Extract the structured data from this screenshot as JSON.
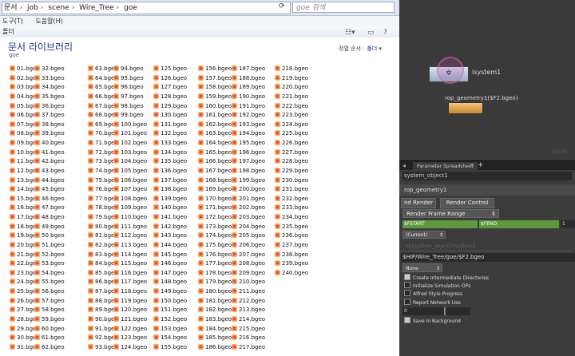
{
  "explorer": {
    "breadcrumb": [
      "문서",
      "job",
      "scene",
      "Wire_Tree",
      "goe"
    ],
    "search_placeholder": "goe 검색",
    "menu": [
      "도구(T)",
      "도움말(H)"
    ],
    "toolbar_label": "폴더",
    "library_title": "문서 라이브러리",
    "library_subtitle": "goe",
    "arrange_label": "정렬 순서:",
    "arrange_value": "폴더",
    "icons": {
      "refresh": "refresh-icon",
      "view": "view-options-icon",
      "preview": "preview-pane-icon",
      "help": "help-icon",
      "file": "bgeo-file-icon"
    },
    "columns": [
      [
        "01.bgeo",
        "02.bgeo",
        "03.bgeo",
        "04.bgeo",
        "05.bgeo",
        "06.bgeo",
        "07.bgeo",
        "08.bgeo",
        "09.bgeo",
        "10.bgeo",
        "11.bgeo",
        "12.bgeo",
        "13.bgeo",
        "14.bgeo",
        "15.bgeo",
        "16.bgeo",
        "17.bgeo",
        "18.bgeo",
        "19.bgeo",
        "20.bgeo",
        "21.bgeo",
        "22.bgeo",
        "23.bgeo",
        "24.bgeo",
        "25.bgeo",
        "26.bgeo",
        "27.bgeo",
        "28.bgeo",
        "29.bgeo",
        "30.bgeo",
        "31.bgeo"
      ],
      [
        "32.bgeo",
        "33.bgeo",
        "34.bgeo",
        "35.bgeo",
        "36.bgeo",
        "37.bgeo",
        "38.bgeo",
        "39.bgeo",
        "40.bgeo",
        "41.bgeo",
        "42.bgeo",
        "43.bgeo",
        "44.bgeo",
        "45.bgeo",
        "46.bgeo",
        "47.bgeo",
        "48.bgeo",
        "49.bgeo",
        "50.bgeo",
        "51.bgeo",
        "52.bgeo",
        "53.bgeo",
        "54.bgeo",
        "55.bgeo",
        "56.bgeo",
        "57.bgeo",
        "58.bgeo",
        "59.bgeo",
        "60.bgeo",
        "61.bgeo",
        "62.bgeo"
      ],
      [
        "63.bgeo",
        "64.bgeo",
        "65.bgeo",
        "66.bgeo",
        "67.bgeo",
        "68.bgeo",
        "69.bgeo",
        "70.bgeo",
        "71.bgeo",
        "72.bgeo",
        "73.bgeo",
        "74.bgeo",
        "75.bgeo",
        "76.bgeo",
        "77.bgeo",
        "78.bgeo",
        "79.bgeo",
        "80.bgeo",
        "81.bgeo",
        "82.bgeo",
        "83.bgeo",
        "84.bgeo",
        "85.bgeo",
        "86.bgeo",
        "87.bgeo",
        "88.bgeo",
        "89.bgeo",
        "90.bgeo",
        "91.bgeo",
        "92.bgeo",
        "93.bgeo"
      ],
      [
        "94.bgeo",
        "95.bgeo",
        "96.bgeo",
        "97.bgeo",
        "98.bgeo",
        "99.bgeo",
        "100.bgeo",
        "101.bgeo",
        "102.bgeo",
        "103.bgeo",
        "104.bgeo",
        "105.bgeo",
        "106.bgeo",
        "107.bgeo",
        "108.bgeo",
        "109.bgeo",
        "110.bgeo",
        "111.bgeo",
        "112.bgeo",
        "113.bgeo",
        "114.bgeo",
        "115.bgeo",
        "116.bgeo",
        "117.bgeo",
        "118.bgeo",
        "119.bgeo",
        "120.bgeo",
        "121.bgeo",
        "122.bgeo",
        "123.bgeo",
        "124.bgeo"
      ],
      [
        "125.bgeo",
        "126.bgeo",
        "127.bgeo",
        "128.bgeo",
        "129.bgeo",
        "130.bgeo",
        "131.bgeo",
        "132.bgeo",
        "133.bgeo",
        "134.bgeo",
        "135.bgeo",
        "136.bgeo",
        "137.bgeo",
        "138.bgeo",
        "139.bgeo",
        "140.bgeo",
        "141.bgeo",
        "142.bgeo",
        "143.bgeo",
        "144.bgeo",
        "145.bgeo",
        "146.bgeo",
        "147.bgeo",
        "148.bgeo",
        "149.bgeo",
        "150.bgeo",
        "151.bgeo",
        "152.bgeo",
        "153.bgeo",
        "154.bgeo",
        "155.bgeo"
      ],
      [
        "156.bgeo",
        "157.bgeo",
        "158.bgeo",
        "159.bgeo",
        "160.bgeo",
        "161.bgeo",
        "162.bgeo",
        "163.bgeo",
        "164.bgeo",
        "165.bgeo",
        "166.bgeo",
        "167.bgeo",
        "168.bgeo",
        "169.bgeo",
        "170.bgeo",
        "171.bgeo",
        "172.bgeo",
        "173.bgeo",
        "174.bgeo",
        "175.bgeo",
        "176.bgeo",
        "177.bgeo",
        "178.bgeo",
        "179.bgeo",
        "180.bgeo",
        "181.bgeo",
        "182.bgeo",
        "183.bgeo",
        "184.bgeo",
        "185.bgeo",
        "186.bgeo"
      ],
      [
        "187.bgeo",
        "188.bgeo",
        "189.bgeo",
        "190.bgeo",
        "191.bgeo",
        "192.bgeo",
        "193.bgeo",
        "194.bgeo",
        "195.bgeo",
        "196.bgeo",
        "197.bgeo",
        "198.bgeo",
        "199.bgeo",
        "200.bgeo",
        "201.bgeo",
        "202.bgeo",
        "203.bgeo",
        "204.bgeo",
        "205.bgeo",
        "206.bgeo",
        "207.bgeo",
        "208.bgeo",
        "209.bgeo",
        "210.bgeo",
        "211.bgeo",
        "212.bgeo",
        "213.bgeo",
        "214.bgeo",
        "215.bgeo",
        "216.bgeo",
        "217.bgeo"
      ],
      [
        "218.bgeo",
        "219.bgeo",
        "220.bgeo",
        "221.bgeo",
        "222.bgeo",
        "223.bgeo",
        "224.bgeo",
        "225.bgeo",
        "226.bgeo",
        "227.bgeo",
        "228.bgeo",
        "229.bgeo",
        "230.bgeo",
        "231.bgeo",
        "232.bgeo",
        "233.bgeo",
        "234.bgeo",
        "235.bgeo",
        "236.bgeo",
        "237.bgeo",
        "238.bgeo",
        "239.bgeo",
        "240.bgeo"
      ]
    ]
  },
  "houdini": {
    "network": {
      "node1_label": "lsystem1",
      "node2_label": "rop_geometry1($F2.bgeo)",
      "ghost_text": "Node"
    },
    "tab": {
      "label": "Parameter Spreadsheet",
      "plus": "+"
    },
    "params": {
      "path": "system_object1",
      "node_name": "rop_geometry1",
      "render_button": "nd Render",
      "render_control_button": "Render Control",
      "range_menu": "Render Frame Range",
      "start": "$FSTART",
      "end": "$FEND",
      "increment": "1",
      "current": "(Current)",
      "dim_path": "obj/system_object1/lsystem1",
      "output_file": "$HIP/Wire_Tree/goe/$F2.bgeo",
      "none_menu": "None",
      "checkboxes": [
        {
          "label": "Create Intermediate Directories",
          "checked": true
        },
        {
          "label": "Initialize Simulation OPs",
          "checked": false
        },
        {
          "label": "Alfred Style Progress",
          "checked": false
        },
        {
          "label": "Report Network Use",
          "checked": false
        }
      ],
      "slider_value": "0",
      "save_background": {
        "label": "Save in Background",
        "checked": true
      }
    }
  }
}
